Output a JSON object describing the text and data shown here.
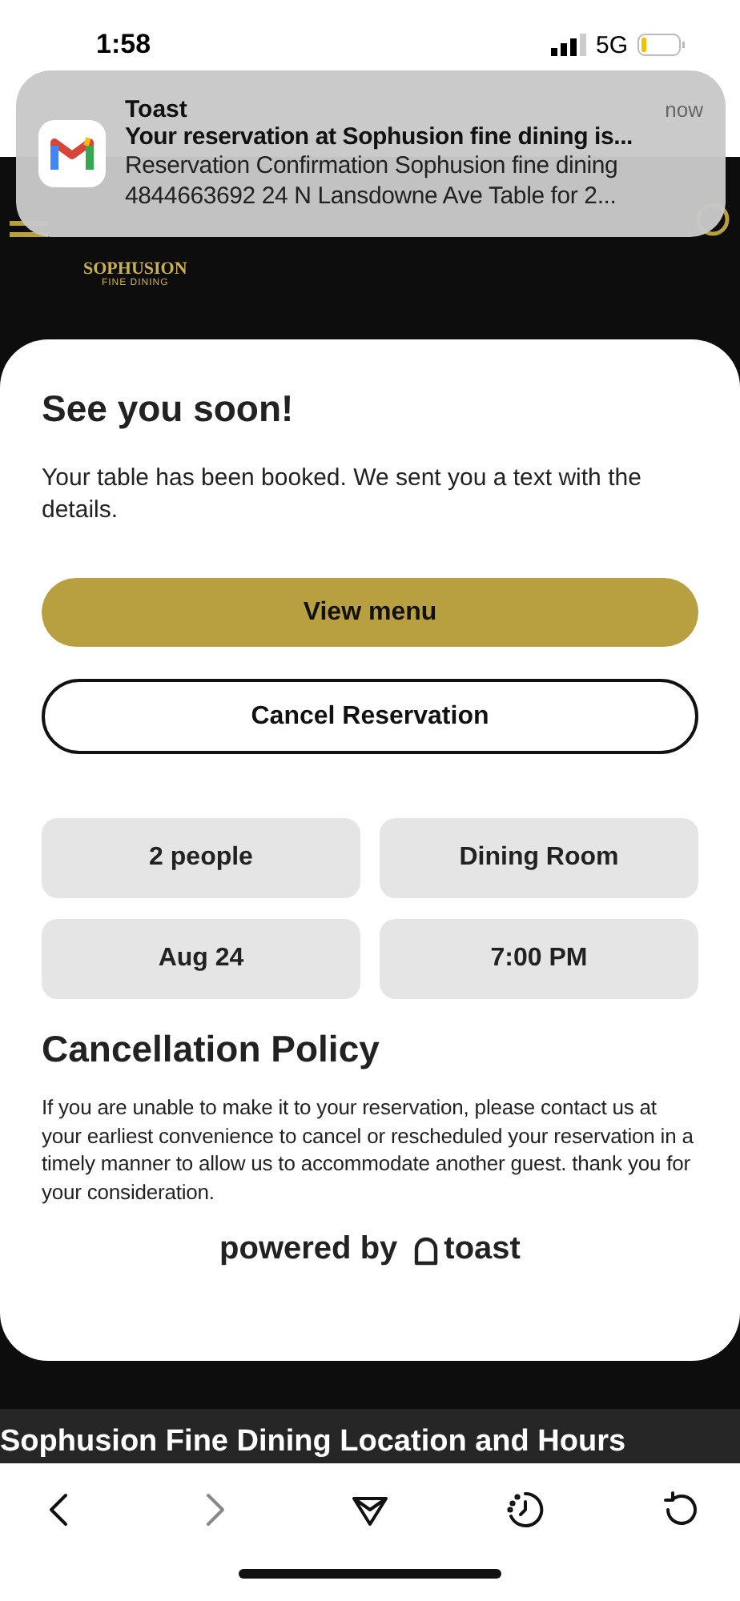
{
  "status_bar": {
    "time": "1:58",
    "network": "5G"
  },
  "notification": {
    "app": "Toast",
    "time": "now",
    "title": "Your reservation at Sophusion fine dining is...",
    "body": "Reservation Confirmation Sophusion fine dining 4844663692 24 N Lansdowne Ave Table for 2..."
  },
  "header": {
    "logo_name": "SOPHUSION",
    "logo_subtitle": "FINE DINING"
  },
  "dialog": {
    "title": "See you soon!",
    "message": "Your table has been booked. We sent you a text with the details.",
    "buttons": [
      {
        "label": "View menu",
        "kind": "primary"
      },
      {
        "label": "Cancel Reservation",
        "kind": "outline"
      }
    ],
    "details": [
      "2 people",
      "Dining Room",
      "Aug 24",
      "7:00 PM"
    ],
    "policy_title": "Cancellation Policy",
    "policy_text": "If you are unable to make it to your reservation, please contact us at your earliest convenience to cancel or rescheduled your reservation in a timely manner to allow us to accommodate another guest. thank you for your consideration.",
    "powered_by": {
      "prefix": "powered by",
      "brand": "toast"
    }
  },
  "section_heading": "Sophusion Fine Dining Location and Hours",
  "toolbar": [
    {
      "kind": "back",
      "disabled": false
    },
    {
      "kind": "forward",
      "disabled": true
    },
    {
      "kind": "share",
      "disabled": false
    },
    {
      "kind": "history",
      "disabled": false
    },
    {
      "kind": "reload",
      "disabled": false
    }
  ]
}
